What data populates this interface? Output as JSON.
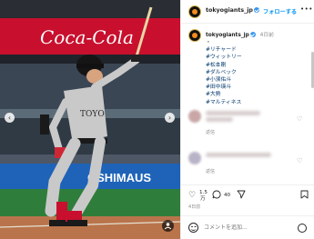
{
  "account": {
    "username": "tokyogiants_jp",
    "follow_label": "フォローする",
    "more_label": "•••"
  },
  "caption": {
    "time_ago": "4日前",
    "first_line": "・",
    "hashtags": [
      "#リチャード",
      "#ウィットリー",
      "#松本剛",
      "#ダルベック",
      "#小濱佑斗",
      "#田中瑛斗",
      "#大勢",
      "#マルティネス"
    ]
  },
  "comments": [
    {
      "reply_label": "返信"
    },
    {
      "reply_label": "返信"
    }
  ],
  "stats": {
    "likes": "1.5",
    "likes_line2": "万",
    "comments": "40"
  },
  "post_date": "4日前",
  "comment_box": {
    "placeholder": "コメントを追加..."
  },
  "photo": {
    "banner_text": "Coca-Cola",
    "ad_text": "OSHIMAUS",
    "jersey_text": "TOYO"
  },
  "icons": {
    "like": "heart-icon",
    "comment": "comment-icon",
    "share": "send-icon",
    "save": "bookmark-icon"
  },
  "colors": {
    "link": "#00376b",
    "follow": "#0095f6",
    "verified": "#3897f0"
  }
}
